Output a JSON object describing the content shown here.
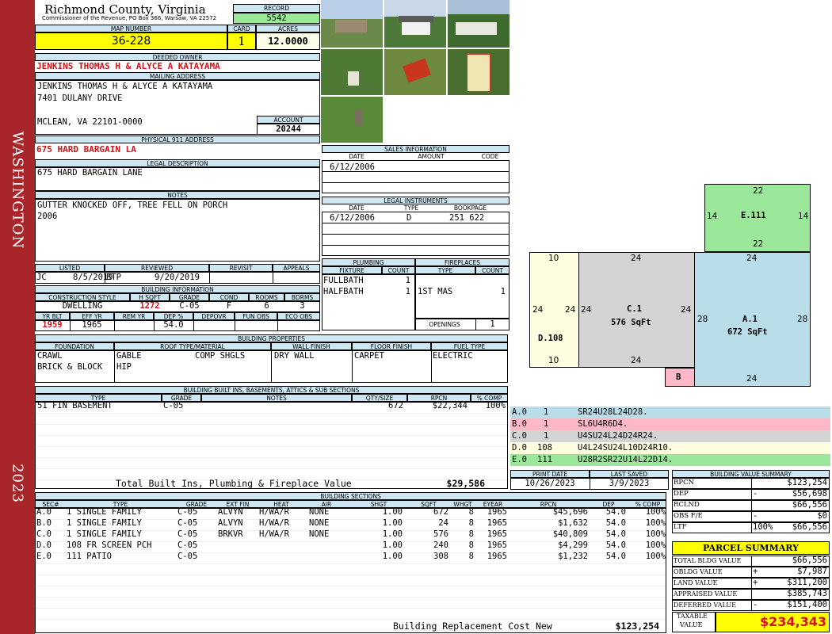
{
  "sidebar": {
    "city": "WASHINGTON",
    "year": "2023"
  },
  "header": {
    "county": "Richmond County, Virginia",
    "commissioner": "Commissioner of the Revenue, PO Box 366, Warsaw, VA 22572",
    "record_label": "RECORD",
    "record": "5542",
    "map_label": "MAP NUMBER",
    "map": "36-228",
    "card_label": "CARD",
    "card": "1",
    "acres_label": "ACRES",
    "acres": "12.0000"
  },
  "owner": {
    "label": "DEEDED OWNER",
    "name": "JENKINS THOMAS H & ALYCE A KATAYAMA",
    "mail_label": "MAILING ADDRESS",
    "mail1": "JENKINS THOMAS H & ALYCE A KATAYAMA",
    "mail2": "7401 DULANY DRIVE",
    "mail3": "MCLEAN, VA 22101-0000",
    "account_label": "ACCOUNT",
    "account": "20244"
  },
  "address": {
    "label": "PHYSICAL 911 ADDRESS",
    "value": "675 HARD BARGAIN LA"
  },
  "legal": {
    "label": "LEGAL DESCRIPTION",
    "value": "675 HARD BARGAIN LANE"
  },
  "notes": {
    "label": "NOTES",
    "line1": "GUTTER KNOCKED OFF, TREE FELL ON PORCH",
    "line2": "2006"
  },
  "listed": {
    "h_listed": "LISTED",
    "h_reviewed": "REVIEWED",
    "h_revisit": "REVISIT",
    "h_appeals": "APPEALS",
    "lister": "JC",
    "listed_date": "8/5/2019",
    "reviewer": "BTP",
    "reviewed_date": "9/20/2019"
  },
  "building_info": {
    "label": "BUILDING INFORMATION",
    "h_style": "CONSTRUCTION STYLE",
    "h_hsqft": "H SQFT",
    "h_grade": "GRADE",
    "h_cond": "COND",
    "h_rooms": "ROOMS",
    "h_bdrms": "BDRMS",
    "style": "DWELLING",
    "hsqft": "1272",
    "grade": "C-05",
    "cond": "F",
    "rooms": "6",
    "bdrms": "3",
    "h_yrblt": "YR BLT",
    "h_effyr": "EFF YR",
    "h_remyr": "REM YR",
    "h_dep": "DEP %",
    "h_depovr": "DEPOVR",
    "h_funobs": "FUN OBS",
    "h_ecoobs": "ECO OBS",
    "yrblt": "1959",
    "effyr": "1965",
    "dep": "54.0"
  },
  "properties": {
    "label": "BUILDING PROPERTIES",
    "h_foundation": "FOUNDATION",
    "h_roof": "ROOF TYPE/MATERIAL",
    "h_wall": "WALL FINISH",
    "h_floor": "FLOOR FINISH",
    "h_fuel": "FUEL TYPE",
    "foundation1": "CRAWL",
    "foundation2": "BRICK & BLOCK",
    "roof1": "GABLE",
    "roof2": "HIP",
    "roof_material": "COMP SHGLS",
    "wall": "DRY WALL",
    "floor": "CARPET",
    "fuel": "ELECTRIC"
  },
  "builtins": {
    "label": "BUILDING BUILT INS, BASEMENTS, ATTICS & SUB SECTIONS",
    "h_type": "TYPE",
    "h_grade": "GRADE",
    "h_notes": "NOTES",
    "h_qty": "QTY/SIZE",
    "h_rpcn": "RPCN",
    "h_comp": "% COMP",
    "rows": [
      {
        "type": "51 FIN BASEMENT",
        "grade": "C-05",
        "notes": "",
        "qty": "672",
        "rpcn": "$22,344",
        "comp": "100%"
      }
    ],
    "total_label": "Total Built Ins, Plumbing & Fireplace Value",
    "total": "$29,586"
  },
  "sales": {
    "label": "SALES INFORMATION",
    "h_date": "DATE",
    "h_amount": "AMOUNT",
    "h_code": "CODE",
    "date": "6/12/2006"
  },
  "legal_instruments": {
    "label": "LEGAL INSTRUMENTS",
    "h_date": "DATE",
    "h_type": "TYPE",
    "h_book": "BOOKPAGE",
    "date": "6/12/2006",
    "type": "D",
    "book": "251 622"
  },
  "plumbing": {
    "label": "PLUMBING",
    "h_fixture": "FIXTURE",
    "h_count": "COUNT",
    "rows": [
      {
        "fixture": "FULLBATH",
        "count": "1"
      },
      {
        "fixture": "HALFBATH",
        "count": "1"
      }
    ]
  },
  "fireplaces": {
    "label": "FIREPLACES",
    "h_type": "TYPE",
    "h_count": "COUNT",
    "type": "1ST MAS",
    "count": "1",
    "openings_label": "OPENINGS",
    "openings": "1"
  },
  "sketch": {
    "e_label": "E.111",
    "e_top": "22",
    "e_bottom": "22",
    "e_left": "14",
    "e_right": "14",
    "a_label": "A.1",
    "a_area": "672 SqFt",
    "a_top": "24",
    "a_bottom": "24",
    "a_left": "28",
    "a_right": "28",
    "c_label": "C.1",
    "c_area": "576 SqFt",
    "c_top": "24",
    "c_bottom": "24",
    "c_left": "24",
    "c_right": "24",
    "d_label": "D.108",
    "d_top": "10",
    "d_bottom": "10",
    "d_left": "24",
    "d_right": "24",
    "b_label": "B"
  },
  "vectors": [
    {
      "sec": "A.0",
      "code": "1",
      "vector": "SR24U28L24D28.",
      "color": "#b9dde9"
    },
    {
      "sec": "B.0",
      "code": "1",
      "vector": "SL6U4R6D4.",
      "color": "#ffb8c8"
    },
    {
      "sec": "C.0",
      "code": "1",
      "vector": "U4SU24L24D24R24.",
      "color": "#d4d4d4"
    },
    {
      "sec": "D.0",
      "code": "108",
      "vector": "U4L24SU24L10D24R10.",
      "color": "#fffde0"
    },
    {
      "sec": "E.0",
      "code": "111",
      "vector": "U28R2SR22U14L22D14.",
      "color": "#9be89b"
    }
  ],
  "dates": {
    "h_print": "PRINT DATE",
    "h_saved": "LAST SAVED",
    "print": "10/26/2023",
    "saved": "3/9/2023"
  },
  "sections": {
    "label": "BUILDING SECTIONS",
    "h_sec": "SEC#",
    "h_type": "TYPE",
    "h_grade": "GRADE",
    "h_ext": "EXT FIN",
    "h_heat": "HEAT",
    "h_air": "AIR",
    "h_shgt": "SHGT",
    "h_sqft": "SQFT",
    "h_whgt": "WHGT",
    "h_eyear": "EYEAR",
    "h_rpcn": "RPCN",
    "h_dep": "DEP",
    "h_comp": "% COMP",
    "rows": [
      {
        "sec": "A.0",
        "type": "1 SINGLE FAMILY",
        "grade": "C-05",
        "ext": "ALVYN",
        "heat": "H/WA/R",
        "air": "NONE",
        "shgt": "1.00",
        "sqft": "672",
        "whgt": "8",
        "eyear": "1965",
        "rpcn": "$45,696",
        "dep": "54.0",
        "comp": "100%"
      },
      {
        "sec": "B.0",
        "type": "1 SINGLE FAMILY",
        "grade": "C-05",
        "ext": "ALVYN",
        "heat": "H/WA/R",
        "air": "NONE",
        "shgt": "1.00",
        "sqft": "24",
        "whgt": "8",
        "eyear": "1965",
        "rpcn": "$1,632",
        "dep": "54.0",
        "comp": "100%"
      },
      {
        "sec": "C.0",
        "type": "1 SINGLE FAMILY",
        "grade": "C-05",
        "ext": "BRKVR",
        "heat": "H/WA/R",
        "air": "NONE",
        "shgt": "1.00",
        "sqft": "576",
        "whgt": "8",
        "eyear": "1965",
        "rpcn": "$40,809",
        "dep": "54.0",
        "comp": "100%"
      },
      {
        "sec": "D.0",
        "type": "108 FR SCREEN PCH",
        "grade": "C-05",
        "ext": "",
        "heat": "",
        "air": "",
        "shgt": "1.00",
        "sqft": "240",
        "whgt": "8",
        "eyear": "1965",
        "rpcn": "$4,299",
        "dep": "54.0",
        "comp": "100%"
      },
      {
        "sec": "E.0",
        "type": "111 PATIO",
        "grade": "C-05",
        "ext": "",
        "heat": "",
        "air": "",
        "shgt": "1.00",
        "sqft": "308",
        "whgt": "8",
        "eyear": "1965",
        "rpcn": "$1,232",
        "dep": "54.0",
        "comp": "100%"
      }
    ],
    "total_label": "Building Replacement Cost New",
    "total": "$123,254"
  },
  "value_summary": {
    "label": "BUILDING VALUE SUMMARY",
    "rows": [
      {
        "k": "RPCN",
        "s": "",
        "v": "$123,254"
      },
      {
        "k": "DEP",
        "s": "-",
        "v": "$56,698"
      },
      {
        "k": "RCLND",
        "s": "",
        "v": "$66,556"
      },
      {
        "k": "OBS F/E",
        "s": "-",
        "v": "$0"
      },
      {
        "k": "LTF",
        "s": "100%",
        "v": "$66,556"
      }
    ]
  },
  "parcel": {
    "label": "PARCEL SUMMARY",
    "rows": [
      {
        "k": "TOTAL BLDG VALUE",
        "s": "",
        "v": "$66,556"
      },
      {
        "k": "OBLDG VALUE",
        "s": "+",
        "v": "$7,987"
      },
      {
        "k": "LAND VALUE",
        "s": "+",
        "v": "$311,200"
      },
      {
        "k": "APPRAISED VALUE",
        "s": "",
        "v": "$385,743"
      },
      {
        "k": "DEFERRED VALUE",
        "s": "-",
        "v": "$151,400"
      }
    ],
    "taxable_label1": "TAXABLE",
    "taxable_label2": "VALUE",
    "taxable": "$234,343"
  }
}
